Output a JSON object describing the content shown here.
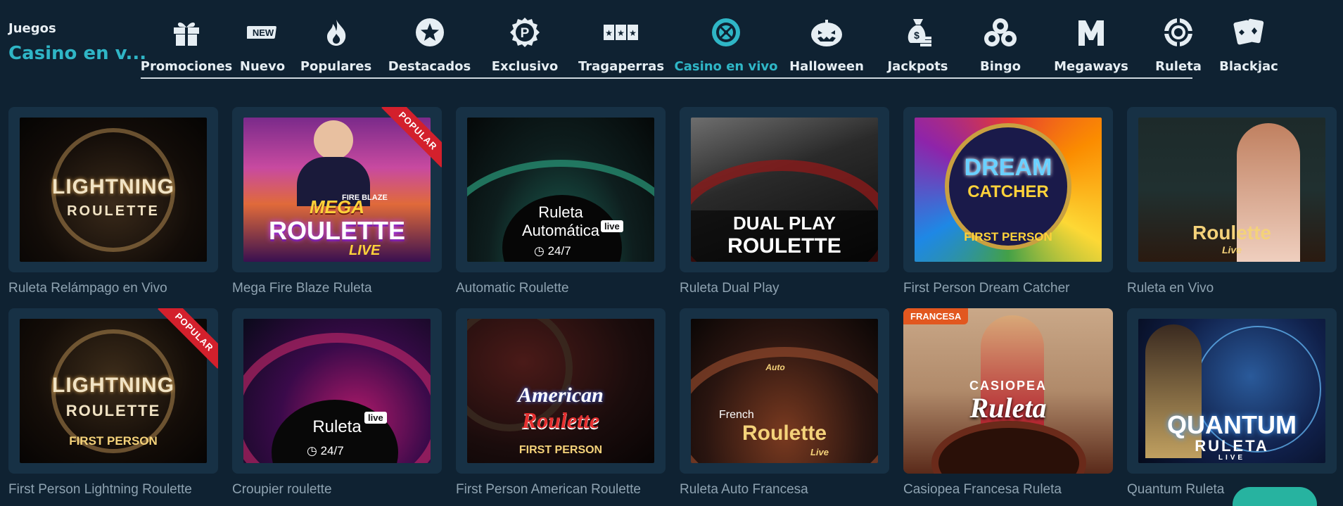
{
  "brand": {
    "section": "Juegos",
    "current": "Casino en v..."
  },
  "nav": [
    {
      "label": "Promociones",
      "icon": "gift-icon"
    },
    {
      "label": "Nuevo",
      "icon": "new-badge-icon"
    },
    {
      "label": "Populares",
      "icon": "fire-icon"
    },
    {
      "label": "Destacados",
      "icon": "star-circle-icon"
    },
    {
      "label": "Exclusivo",
      "icon": "p-badge-icon"
    },
    {
      "label": "Tragaperras",
      "icon": "slots-icon"
    },
    {
      "label": "Casino en vivo",
      "icon": "roulette-wheel-icon",
      "active": true
    },
    {
      "label": "Halloween",
      "icon": "pumpkin-icon"
    },
    {
      "label": "Jackpots",
      "icon": "money-bag-icon"
    },
    {
      "label": "Bingo",
      "icon": "bingo-balls-icon"
    },
    {
      "label": "Megaways",
      "icon": "megaways-m-icon"
    },
    {
      "label": "Ruleta",
      "icon": "chip-icon"
    },
    {
      "label": "Blackjac",
      "icon": "cards-icon"
    }
  ],
  "new_badge_text": "NEW",
  "ribbon_text": "POPULAR",
  "francesa_tag": "FRANCESA",
  "live_text": "live",
  "hours_text": "24/7",
  "games": [
    {
      "title": "Ruleta Relámpago en Vivo",
      "art": [
        "LIGHTNING",
        "ROULETTE"
      ],
      "bg": "bg-lightning"
    },
    {
      "title": "Mega Fire Blaze Ruleta",
      "art": [
        "MEGA",
        "FIRE BLAZE",
        "ROULETTE",
        "LIVE"
      ],
      "bg": "bg-mega",
      "popular": true
    },
    {
      "title": "Automatic Roulette",
      "art": [
        "Ruleta",
        "Automática"
      ],
      "bg": "bg-auto"
    },
    {
      "title": "Ruleta Dual Play",
      "art": [
        "DUAL PLAY",
        "ROULETTE"
      ],
      "bg": "bg-dual"
    },
    {
      "title": "First Person Dream Catcher",
      "art": [
        "DREAM",
        "CATCHER",
        "FIRST PERSON"
      ],
      "bg": "bg-dream"
    },
    {
      "title": "Ruleta en Vivo",
      "art": [
        "Roulette",
        "Live"
      ],
      "bg": "bg-vivo"
    },
    {
      "title": "First Person Lightning Roulette",
      "art": [
        "LIGHTNING",
        "ROULETTE",
        "FIRST PERSON"
      ],
      "bg": "bg-lightning2",
      "popular": true
    },
    {
      "title": "Croupier roulette",
      "art": [
        "Ruleta"
      ],
      "bg": "bg-croupier"
    },
    {
      "title": "First Person American Roulette",
      "art": [
        "American",
        "Roulette",
        "FIRST PERSON"
      ],
      "bg": "bg-american"
    },
    {
      "title": "Ruleta Auto Francesa",
      "art": [
        "Auto",
        "French",
        "Roulette",
        "Live"
      ],
      "bg": "bg-french"
    },
    {
      "title": "Casiopea Francesa Ruleta",
      "art": [
        "CASIOPEA",
        "Ruleta"
      ],
      "bg": "bg-casiopea",
      "francesa": true
    },
    {
      "title": "Quantum Ruleta",
      "art": [
        "QUANTUM",
        "RULETA",
        "LIVE"
      ],
      "bg": "bg-quantum"
    }
  ]
}
